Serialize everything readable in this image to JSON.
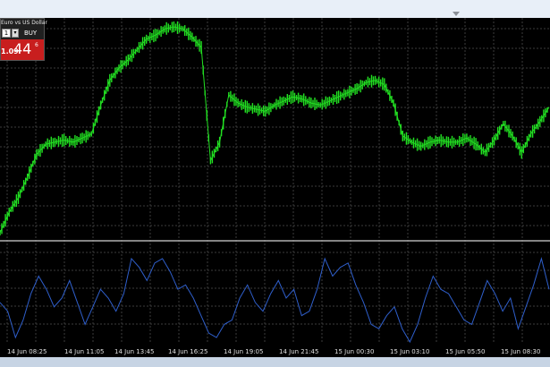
{
  "trade_panel": {
    "symbol": "Euro vs US Dollar",
    "lot_value": "1",
    "spinner_glyph": "▾",
    "buy_label": "BUY",
    "buy_price_prefix": "1.09",
    "buy_price_big": "44",
    "buy_price_small": "6"
  },
  "colors": {
    "background": "#000000",
    "grid": "#3c3c3c",
    "bull_candle": "#22e022",
    "indicator_line": "#2f5fcc",
    "separator": "#b0b0b0",
    "time_label": "#e0e0e0",
    "buy_button": "#c81e1e"
  },
  "chart_data": [
    {
      "type": "line",
      "title": "",
      "xlabel": "",
      "ylabel": "",
      "x": [
        "14 Jun 08:25",
        "14 Jun 11:05",
        "14 Jun 13:45",
        "14 Jun 16:25",
        "14 Jun 19:05",
        "14 Jun 21:45",
        "15 Jun 00:30",
        "15 Jun 03:10",
        "15 Jun 05:50",
        "15 Jun 08:30"
      ],
      "series": [
        {
          "values": [
            0.0,
            0.1,
            0.17,
            0.27,
            0.38,
            0.43,
            0.44,
            0.45,
            0.44,
            0.46,
            0.48,
            0.62,
            0.74,
            0.8,
            0.84,
            0.89,
            0.94,
            0.96,
            0.99,
            1.0,
            0.99,
            0.95,
            0.9,
            0.35,
            0.44,
            0.67,
            0.63,
            0.61,
            0.6,
            0.59,
            0.62,
            0.64,
            0.66,
            0.65,
            0.63,
            0.62,
            0.64,
            0.66,
            0.68,
            0.7,
            0.73,
            0.74,
            0.72,
            0.63,
            0.47,
            0.44,
            0.42,
            0.44,
            0.45,
            0.44,
            0.44,
            0.46,
            0.43,
            0.39,
            0.45,
            0.53,
            0.47,
            0.39,
            0.48,
            0.54,
            0.61
          ]
        },
        {
          "values": [
            0.45,
            0.35,
            0.05,
            0.25,
            0.55,
            0.75,
            0.6,
            0.4,
            0.5,
            0.7,
            0.45,
            0.2,
            0.4,
            0.6,
            0.5,
            0.35,
            0.55,
            0.95,
            0.85,
            0.7,
            0.9,
            0.95,
            0.8,
            0.6,
            0.65,
            0.5,
            0.3,
            0.1,
            0.05,
            0.2,
            0.25,
            0.5,
            0.65,
            0.45,
            0.35,
            0.55,
            0.7,
            0.5,
            0.6,
            0.3,
            0.35,
            0.6,
            0.95,
            0.75,
            0.85,
            0.9,
            0.65,
            0.45,
            0.2,
            0.15,
            0.3,
            0.4,
            0.15,
            0.0,
            0.2,
            0.5,
            0.75,
            0.6,
            0.55,
            0.4,
            0.25,
            0.2,
            0.45,
            0.7,
            0.55,
            0.35,
            0.5,
            0.15,
            0.4,
            0.65,
            0.95,
            0.6
          ]
        }
      ]
    }
  ]
}
